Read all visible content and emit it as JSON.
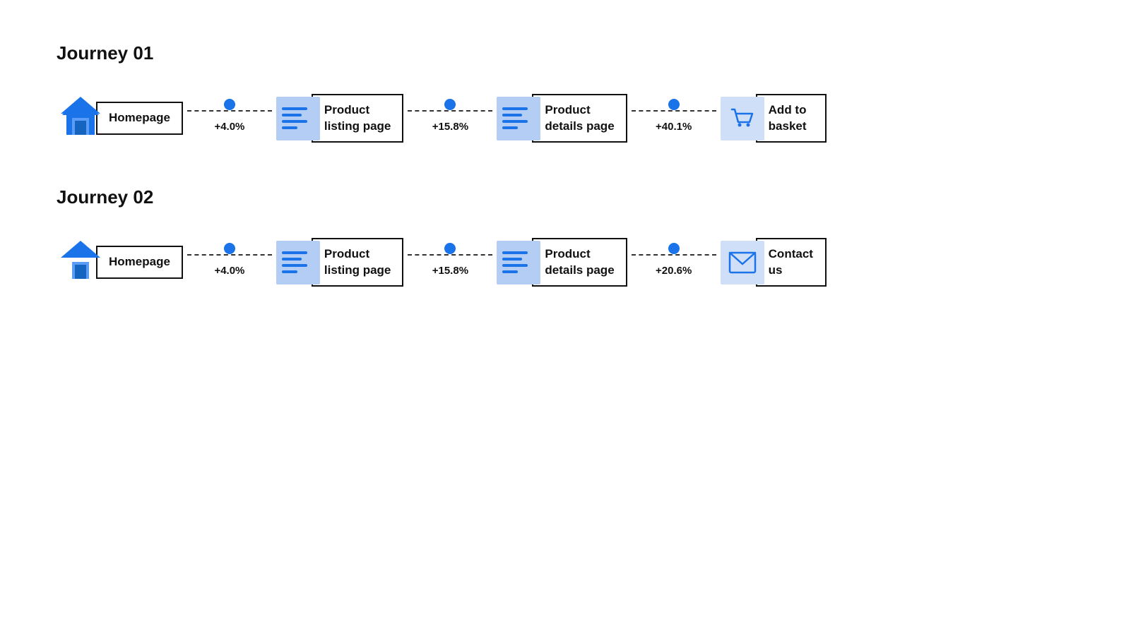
{
  "journeys": [
    {
      "id": "journey-01",
      "title": "Journey 01",
      "steps": [
        {
          "id": "homepage",
          "label": "Homepage",
          "icon": "house"
        },
        {
          "id": "product-listing",
          "label": "Product\nlisting page",
          "icon": "page"
        },
        {
          "id": "product-details",
          "label": "Product\ndetails page",
          "icon": "page"
        },
        {
          "id": "add-to-basket",
          "label": "Add to\nbasket",
          "icon": "cart"
        }
      ],
      "connectors": [
        {
          "pct": "+4.0%"
        },
        {
          "pct": "+15.8%"
        },
        {
          "pct": "+40.1%"
        }
      ]
    },
    {
      "id": "journey-02",
      "title": "Journey 02",
      "steps": [
        {
          "id": "homepage2",
          "label": "Homepage",
          "icon": "house"
        },
        {
          "id": "product-listing2",
          "label": "Product\nlisting page",
          "icon": "page"
        },
        {
          "id": "product-details2",
          "label": "Product\ndetails page",
          "icon": "page"
        },
        {
          "id": "contact-us",
          "label": "Contact\nus",
          "icon": "envelope"
        }
      ],
      "connectors": [
        {
          "pct": "+4.0%"
        },
        {
          "pct": "+15.8%"
        },
        {
          "pct": "+20.6%"
        }
      ]
    }
  ]
}
